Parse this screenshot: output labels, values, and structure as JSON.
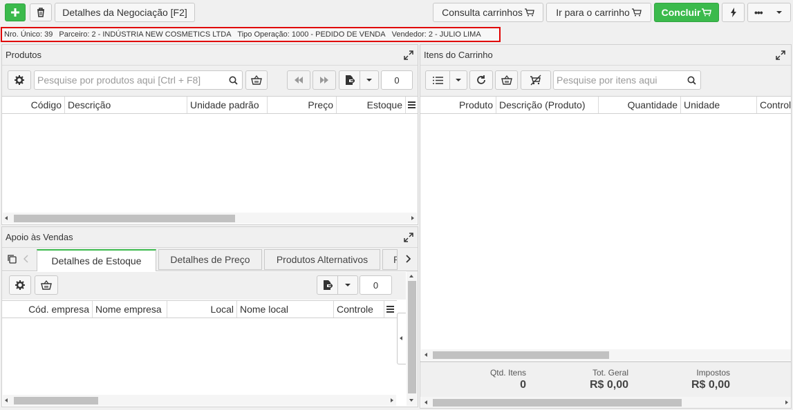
{
  "top_toolbar": {
    "negotiation_details_label": "Detalhes da Negociação [F2]",
    "cart_query_label": "Consulta carrinhos",
    "go_to_cart_label": "Ir para o carrinho",
    "finish_label": "Concluir",
    "accent_color": "#3bba4c"
  },
  "info_bar": {
    "unique_number": "Nro. Único: 39",
    "partner": "Parceiro: 2 - INDÚSTRIA NEW COSMETICS LTDA",
    "operation_type": "Tipo Operação: 1000 - PEDIDO DE VENDA",
    "seller": "Vendedor: 2 - JULIO LIMA",
    "highlight_color": "#e00000"
  },
  "products_panel": {
    "title": "Produtos",
    "search_placeholder": "Pesquise por produtos aqui [Ctrl + F8]",
    "count": "0",
    "columns": [
      "Código",
      "Descrição",
      "Unidade padrão",
      "Preço",
      "Estoque"
    ]
  },
  "cart_panel": {
    "title": "Itens do Carrinho",
    "search_placeholder": "Pesquise por itens aqui",
    "columns": [
      "Produto",
      "Descrição (Produto)",
      "Quantidade",
      "Unidade",
      "Control"
    ],
    "totals": {
      "items_label": "Qtd. Itens",
      "items_value": "0",
      "total_label": "Tot. Geral",
      "total_value": "R$ 0,00",
      "taxes_label": "Impostos",
      "taxes_value": "R$ 0,00"
    }
  },
  "sales_support_panel": {
    "title": "Apoio às Vendas",
    "tabs": [
      "Detalhes de Estoque",
      "Detalhes de Preço",
      "Produtos Alternativos",
      "P"
    ],
    "active_tab": "Detalhes de Estoque",
    "count": "0",
    "columns": [
      "Cód. empresa",
      "Nome empresa",
      "Local",
      "Nome local",
      "Controle"
    ]
  }
}
